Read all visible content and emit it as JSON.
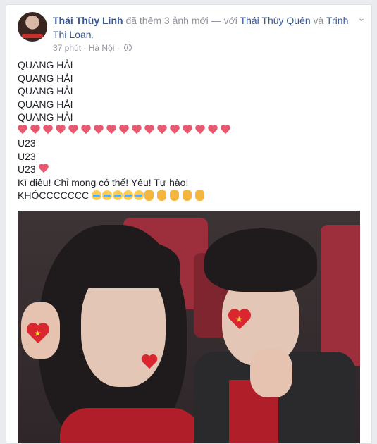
{
  "post": {
    "author": "Thái Thùy Linh",
    "action": "đã thêm 3 ảnh mới",
    "with_sep": "— với",
    "tagged_1": "Thái Thùy Quên",
    "and_word": "và",
    "tagged_2": "Trịnh Thị Loan",
    "timestamp": "37 phút",
    "location": "Hà Nội",
    "privacy_icon": "globe-icon",
    "menu_icon": "chevron-down-icon"
  },
  "text_lines": [
    "QUANG HẢI",
    "QUANG HẢI",
    "QUANG HẢI",
    "QUANG HẢI",
    "QUANG HẢI"
  ],
  "heart_count": 17,
  "u23_lines": [
    "U23",
    "U23",
    "U23"
  ],
  "line_wonder": "Kì diệu! Chỉ mong có thế! Yêu! Tự hào!",
  "line_cry": "KHÓCCCCCCC",
  "emoji_cry_count": 5,
  "emoji_fist_count": 5,
  "colors": {
    "link": "#365899",
    "meta": "#90949c",
    "heart": "#e8586e",
    "flag_red": "#d9262f",
    "flag_star": "#f6d23a"
  },
  "photo": {
    "alt": "selfie-photo"
  }
}
